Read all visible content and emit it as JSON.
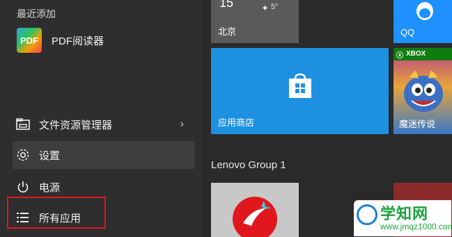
{
  "start_menu": {
    "recent_label": "最近添加",
    "recent_apps": [
      {
        "label": "PDF阅读器",
        "icon": "pdf-reader-icon",
        "icon_text": "PDF"
      }
    ],
    "items": [
      {
        "label": "文件资源管理器",
        "icon": "file-explorer-icon",
        "has_submenu": true
      },
      {
        "label": "设置",
        "icon": "gear-icon"
      },
      {
        "label": "电源",
        "icon": "power-icon"
      },
      {
        "label": "所有应用",
        "icon": "all-apps-list-icon"
      }
    ]
  },
  "tiles": {
    "weather": {
      "temp": "15",
      "low": "5°",
      "city": "北京"
    },
    "qq": {
      "label": "QQ",
      "color": "#1e90ff"
    },
    "store": {
      "label": "应用商店",
      "color": "#1e90e0"
    },
    "xbox": {
      "label": "XBOX",
      "game_label": "魔迷传说"
    },
    "group_label": "Lenovo Group 1"
  },
  "watermark": {
    "title": "学知网",
    "url": "www.jmqz1000.com"
  },
  "colors": {
    "highlight": "#e0181d",
    "tile_blue": "#1e90e0",
    "watermark_green": "#1aa33a"
  }
}
